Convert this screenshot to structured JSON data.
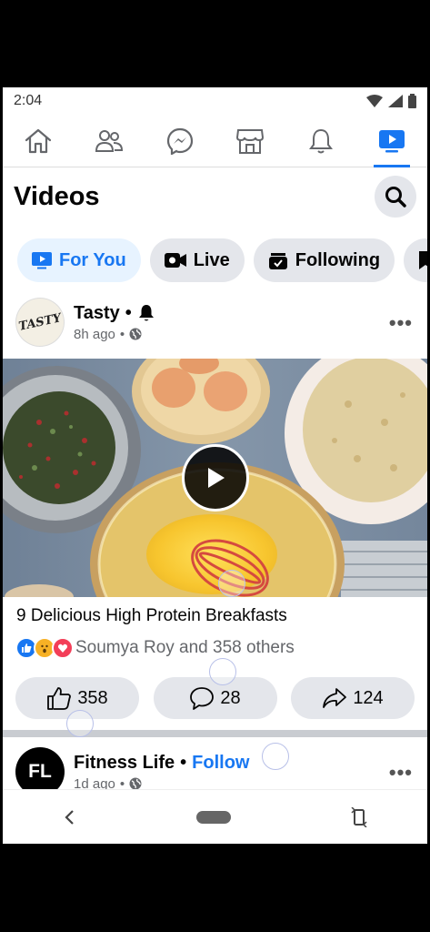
{
  "status": {
    "time": "2:04"
  },
  "nav": {
    "items": [
      {
        "name": "home",
        "icon": "home-icon"
      },
      {
        "name": "friends",
        "icon": "friends-icon"
      },
      {
        "name": "messenger",
        "icon": "messenger-icon"
      },
      {
        "name": "marketplace",
        "icon": "marketplace-icon"
      },
      {
        "name": "notifications",
        "icon": "bell-icon"
      },
      {
        "name": "videos",
        "icon": "video-icon",
        "active": true
      }
    ]
  },
  "header": {
    "title": "Videos"
  },
  "chips": [
    {
      "label": "For You",
      "active": true,
      "icon": "video-play-icon"
    },
    {
      "label": "Live",
      "active": false,
      "icon": "live-camera-icon"
    },
    {
      "label": "Following",
      "active": false,
      "icon": "following-icon"
    },
    {
      "label": "",
      "active": false,
      "icon": "saved-icon"
    }
  ],
  "post1": {
    "page_name": "Tasty",
    "separator": "•",
    "time": "8h ago",
    "time_sep": "•",
    "avatar_text": "TASTY",
    "caption": "9 Delicious High Protein Breakfasts",
    "reactions_text": "Soumya Roy and 358 others",
    "like_count": "358",
    "comment_count": "28",
    "share_count": "124"
  },
  "post2": {
    "page_name": "Fitness Life",
    "separator": "•",
    "follow_label": "Follow",
    "time": "1d ago",
    "time_sep": "•",
    "avatar_text": "FL"
  },
  "colors": {
    "accent": "#1877f2",
    "chip_bg": "#e4e6eb",
    "active_chip_bg": "#e7f3ff",
    "like_blue": "#1877f2",
    "love_red": "#f33e58",
    "wow_yellow": "#f7b125"
  }
}
